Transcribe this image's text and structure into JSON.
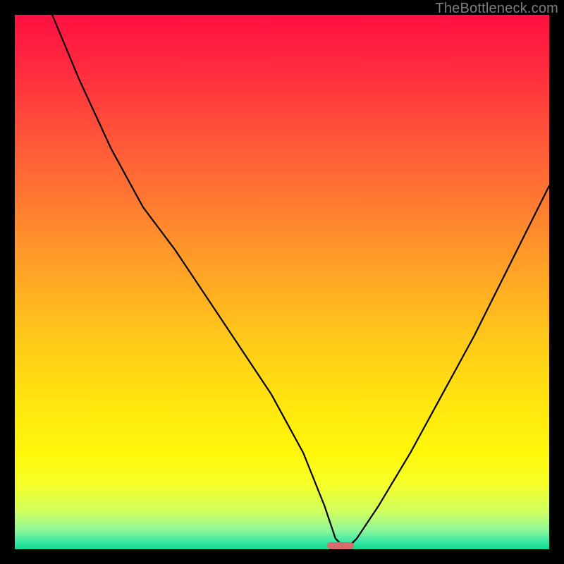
{
  "watermark": "TheBottleneck.com",
  "chart_data": {
    "type": "line",
    "title": "",
    "xlabel": "",
    "ylabel": "",
    "xlim": [
      0,
      100
    ],
    "ylim": [
      0,
      100
    ],
    "grid": false,
    "legend": false,
    "series": [
      {
        "name": "bottleneck-curve",
        "x": [
          7,
          12,
          18,
          24,
          30,
          36,
          42,
          48,
          54,
          58,
          60,
          62,
          64,
          68,
          74,
          80,
          86,
          92,
          100
        ],
        "values": [
          100,
          88,
          75,
          64,
          56,
          47,
          38,
          29,
          18,
          8,
          2,
          0,
          2,
          8,
          18,
          29,
          40,
          52,
          68
        ]
      }
    ],
    "optimal_marker": {
      "x": 61,
      "y": 0,
      "width": 5,
      "height": 1.3
    },
    "background_gradient": {
      "stops": [
        {
          "pos": 0.0,
          "color": "#ff1041"
        },
        {
          "pos": 0.1,
          "color": "#ff2b3f"
        },
        {
          "pos": 0.22,
          "color": "#ff5239"
        },
        {
          "pos": 0.35,
          "color": "#ff7a31"
        },
        {
          "pos": 0.48,
          "color": "#ffa326"
        },
        {
          "pos": 0.6,
          "color": "#ffc71a"
        },
        {
          "pos": 0.72,
          "color": "#ffe40e"
        },
        {
          "pos": 0.82,
          "color": "#fff80a"
        },
        {
          "pos": 0.88,
          "color": "#f6ff2a"
        },
        {
          "pos": 0.93,
          "color": "#d0ff60"
        },
        {
          "pos": 0.965,
          "color": "#8cf79a"
        },
        {
          "pos": 0.985,
          "color": "#3de9a5"
        },
        {
          "pos": 1.0,
          "color": "#0fdc8f"
        }
      ]
    }
  }
}
